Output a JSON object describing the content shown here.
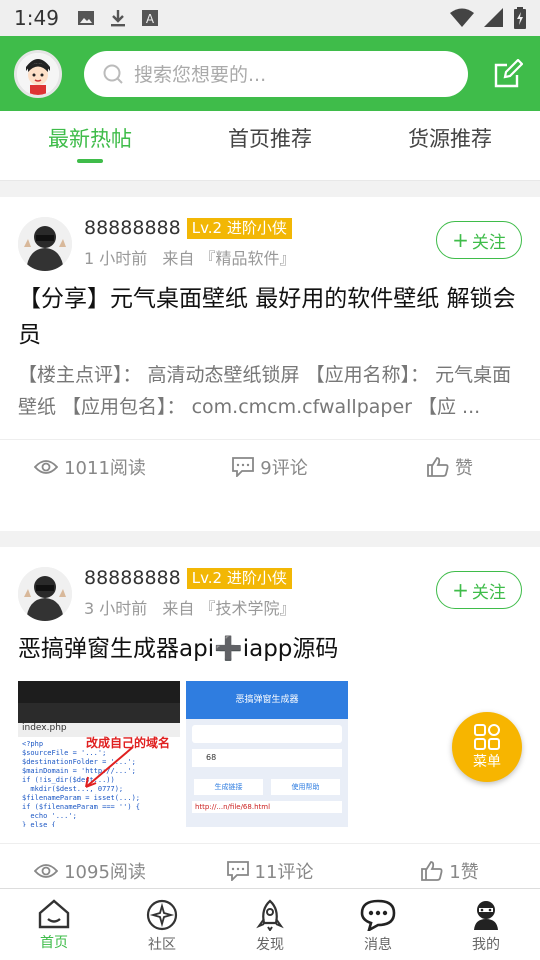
{
  "status_bar": {
    "time": "1:49"
  },
  "header": {
    "search_placeholder": "搜索您想要的..."
  },
  "tabs": [
    {
      "label": "最新热帖",
      "active": true
    },
    {
      "label": "首页推荐",
      "active": false
    },
    {
      "label": "货源推荐",
      "active": false
    }
  ],
  "posts": [
    {
      "username": "88888888",
      "level": "Lv.2 进阶小侠",
      "time": "1 小时前",
      "source": "来自 『精品软件』",
      "follow_label": "关注",
      "title": "【分享】元气桌面壁纸 最好用的软件壁纸 解锁会员",
      "excerpt": "【楼主点评】： 高清动态壁纸锁屏 【应用名称】： 元气桌面壁纸 【应用包名】： com.cmcm.cfwallpaper 【应 ...",
      "views": "1011阅读",
      "comments": "9评论",
      "likes": "赞"
    },
    {
      "username": "88888888",
      "level": "Lv.2 进阶小侠",
      "time": "3 小时前",
      "source": "来自 『技术学院』",
      "follow_label": "关注",
      "title": "恶搞弹窗生成器api➕iapp源码",
      "thumb1_caption": "改成自己的域名",
      "thumb2_header": "恶搞弹窗生成器",
      "thumb2_field": "68",
      "thumb2_btn1": "生成链接",
      "thumb2_btn2": "使用帮助",
      "thumb2_url": "http://...n/file/68.html",
      "views": "1095阅读",
      "comments": "11评论",
      "likes": "1赞"
    }
  ],
  "fab": {
    "label": "菜单"
  },
  "bottom_nav": [
    {
      "label": "首页",
      "icon": "home-icon",
      "active": true
    },
    {
      "label": "社区",
      "icon": "community-icon",
      "active": false
    },
    {
      "label": "发现",
      "icon": "rocket-icon",
      "active": false
    },
    {
      "label": "消息",
      "icon": "message-icon",
      "active": false
    },
    {
      "label": "我的",
      "icon": "profile-icon",
      "active": false
    }
  ],
  "colors": {
    "accent": "#3fbc4a",
    "badge": "#f2b705",
    "fab": "#f7b500"
  }
}
